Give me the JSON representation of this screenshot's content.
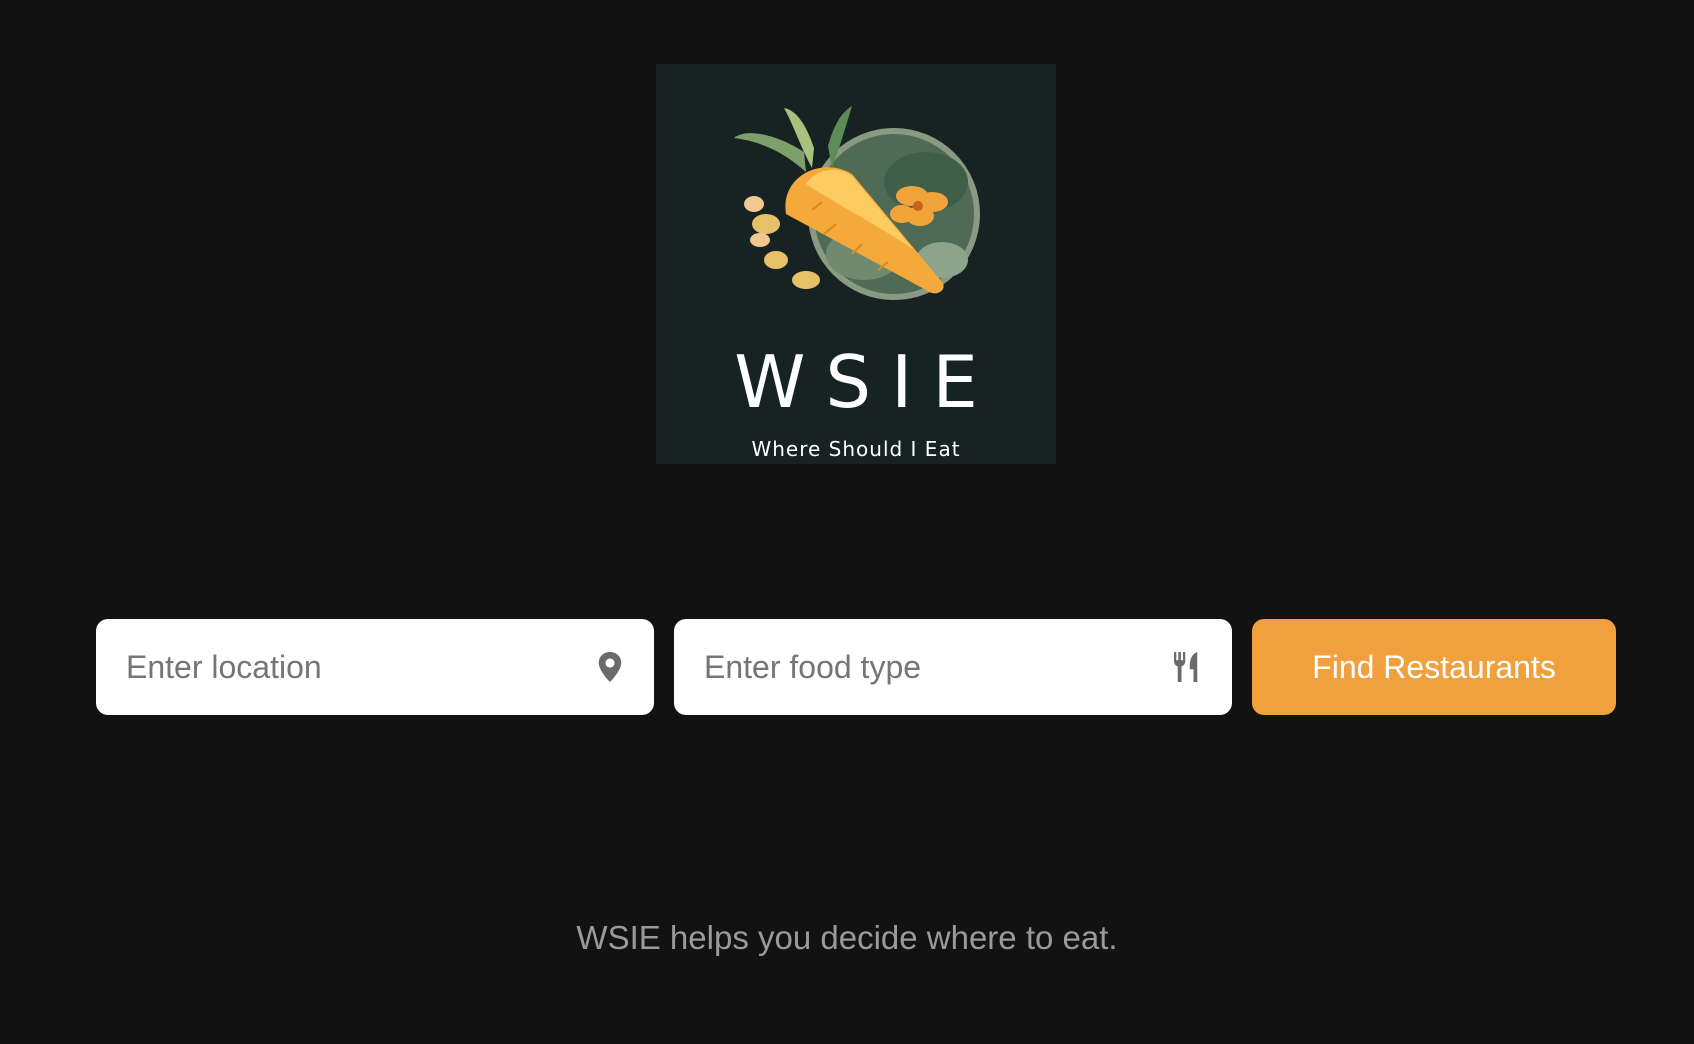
{
  "logo": {
    "wordmark": "WSIE",
    "tagline": "Where Should I Eat",
    "background_color": "#172322"
  },
  "search": {
    "location_placeholder": "Enter location",
    "location_value": "",
    "location_icon": "map-pin-icon",
    "food_placeholder": "Enter food type",
    "food_value": "",
    "food_icon": "fork-knife-icon",
    "submit_label": "Find Restaurants"
  },
  "description": "WSIE helps you decide where to eat.",
  "colors": {
    "background": "#121212",
    "accent": "#f0a03c",
    "field_background": "#ffffff",
    "muted_text": "#9a9a9a",
    "icon": "#6b6b6b"
  }
}
